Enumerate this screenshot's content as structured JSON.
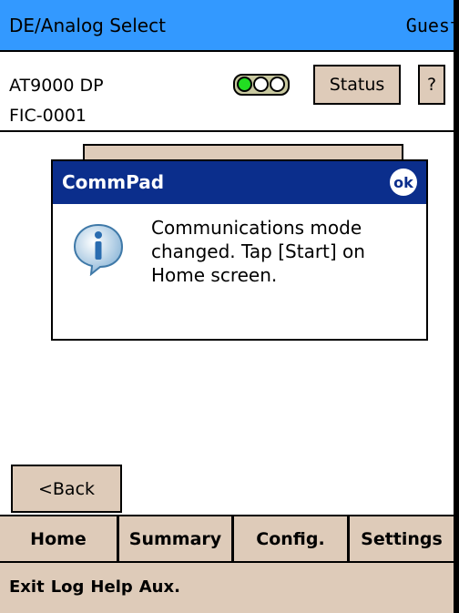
{
  "titlebar": {
    "title": "DE/Analog Select",
    "user": "Guest"
  },
  "device": {
    "model": "AT9000 DP",
    "tag": "FIC-0001"
  },
  "buttons": {
    "status": "Status",
    "help": "?",
    "back": "<Back"
  },
  "dialog": {
    "title": "CommPad",
    "ok": "ok",
    "message": "Communications mode changed. Tap [Start] on Home screen."
  },
  "nav": {
    "tabs": [
      "Home",
      "Summary",
      "Config.",
      "Settings"
    ]
  },
  "menu": {
    "items": [
      "Exit",
      "Log",
      "Help",
      "Aux."
    ]
  },
  "colors": {
    "titlebar": "#3399ff",
    "dialog_header": "#0b2e8c",
    "button_bg": "#decbb9",
    "signal_active": "#22dd22"
  },
  "icons": {
    "signal": "traffic-light-icon",
    "info": "info-icon",
    "ok": "ok-icon"
  }
}
